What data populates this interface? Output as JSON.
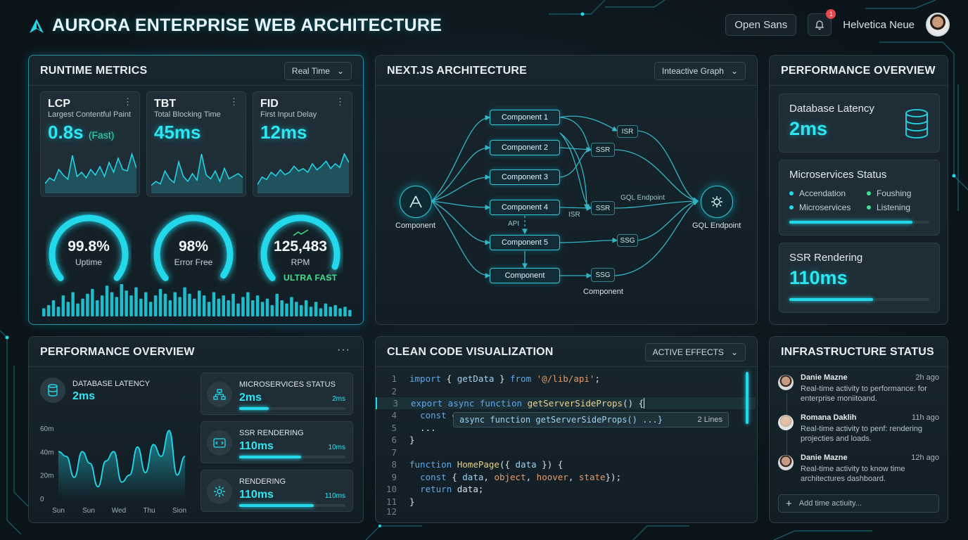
{
  "header": {
    "title": "AURORA  ENTERPRISE WEB ARCHITECTURE",
    "font_chip": "Open Sans",
    "notif_count": "1",
    "user_name": "Helvetica Neue",
    "accent": "#22d8ea"
  },
  "runtime": {
    "title": "RUNTIME METRICS",
    "dropdown": "Real Time",
    "metrics": [
      {
        "key": "LCP",
        "sub": "Largest Contentful Paint",
        "value": "0.8s",
        "note": "(Fast)",
        "spark": [
          10,
          18,
          14,
          30,
          22,
          16,
          50,
          20,
          26,
          18,
          30,
          22,
          34,
          20,
          40,
          26,
          46,
          30,
          28,
          52,
          32
        ]
      },
      {
        "key": "TBT",
        "sub": "Total Blocking Time",
        "value": "45ms",
        "note": "",
        "spark": [
          8,
          14,
          10,
          30,
          18,
          12,
          44,
          22,
          14,
          26,
          16,
          56,
          24,
          18,
          30,
          14,
          34,
          18,
          22,
          26,
          20
        ]
      },
      {
        "key": "FID",
        "sub": "First Input Delay",
        "value": "12ms",
        "note": "",
        "spark": [
          10,
          22,
          18,
          30,
          24,
          34,
          26,
          30,
          40,
          32,
          36,
          30,
          44,
          34,
          40,
          48,
          36,
          44,
          38,
          60,
          46
        ]
      }
    ],
    "gauges": [
      {
        "value": "99.8%",
        "label": "Uptime",
        "pct": 99.8
      },
      {
        "value": "98%",
        "label": "Error Free",
        "pct": 98
      },
      {
        "value": "125,483",
        "label": "RPM",
        "pct": 92
      }
    ],
    "ultra": "ULTRA FAST",
    "wave": [
      10,
      14,
      20,
      12,
      26,
      18,
      30,
      16,
      22,
      28,
      34,
      20,
      26,
      38,
      30,
      24,
      40,
      32,
      26,
      36,
      22,
      30,
      18,
      26,
      34,
      28,
      20,
      30,
      24,
      36,
      28,
      22,
      32,
      26,
      18,
      30,
      22,
      26,
      20,
      28,
      16,
      24,
      30,
      20,
      26,
      18,
      22,
      14,
      28,
      20,
      16,
      24,
      18,
      14,
      20,
      12,
      18,
      10,
      16,
      12,
      14,
      10,
      12,
      8
    ]
  },
  "arch": {
    "title": "NEXT.JS ARCHITECTURE",
    "dropdown": "Inteactive Graph",
    "left_label": "Component",
    "right_label": "GQL Endpoint",
    "nodes": [
      "Component 1",
      "Component 2",
      "Component 3",
      "Component 4",
      "Component 5",
      "Component"
    ],
    "tags": [
      "ISR",
      "SSR",
      "SSR",
      "SSG",
      "SSG"
    ],
    "edge_labels": {
      "gql": "GQL Endpoint",
      "isr": "ISR",
      "api": "API",
      "bottom": "Component"
    }
  },
  "perf_top": {
    "title": "PERFORMANCE OVERVIEW",
    "db": {
      "label": "Database Latency",
      "value": "2ms"
    },
    "svc": {
      "label": "Microservices Status",
      "items": [
        {
          "name": "Accendation",
          "color": "#22d8ea"
        },
        {
          "name": "Foushing",
          "color": "#3ce38e"
        },
        {
          "name": "Microservices",
          "color": "#22d8ea"
        },
        {
          "name": "Listening",
          "color": "#3ce38e"
        }
      ],
      "progress": 0.88
    },
    "ssr": {
      "label": "SSR Rendering",
      "value": "110ms",
      "progress": 0.6
    }
  },
  "perf_bottom": {
    "title": "PERFORMANCE OVERVIEW",
    "menu": "···",
    "db_label": "DATABASE LATENCY",
    "db_value": "2ms",
    "chart_data": {
      "type": "area",
      "categories": [
        "Sun",
        "Sun",
        "Wed",
        "Thu",
        "Sion"
      ],
      "y_ticks": [
        "60m",
        "40m",
        "20m",
        "0"
      ],
      "ylim": [
        0,
        60
      ],
      "values": [
        40,
        36,
        18,
        40,
        30,
        10,
        32,
        40,
        14,
        20,
        44,
        22,
        46,
        36,
        58,
        20,
        36
      ]
    },
    "side": [
      {
        "title": "MICROSERVICES STATUS",
        "value": "2ms",
        "right": "2ms",
        "progress": 0.28
      },
      {
        "title": "SSR RENDERING",
        "value": "110ms",
        "right": "10ms",
        "progress": 0.58
      },
      {
        "title": "RENDERING",
        "value": "110ms",
        "right": "110ms",
        "progress": 0.7
      }
    ]
  },
  "code": {
    "title": "CLEAN CODE VISUALIZATION",
    "dropdown": "ACTIVE EFFECTS",
    "tooltip": "async function getServerSideProps() ...}",
    "tooltip_right": "2 Lines"
  },
  "infra": {
    "title": "INFRASTRUCTURE STATUS",
    "menu": "···",
    "activities": [
      {
        "name": "Danie Mazne",
        "time": "2h ago",
        "desc": "Real-time activity to performance: for enterprise moniitoand."
      },
      {
        "name": "Romana Daklih",
        "time": "11h ago",
        "desc": "Real-time activity to penf: rendering projecties and loads."
      },
      {
        "name": "Danie Mazne",
        "time": "12h ago",
        "desc": "Real-time activity to know time architectures dashboard."
      }
    ],
    "add_placeholder": "Add time actiuity..."
  }
}
